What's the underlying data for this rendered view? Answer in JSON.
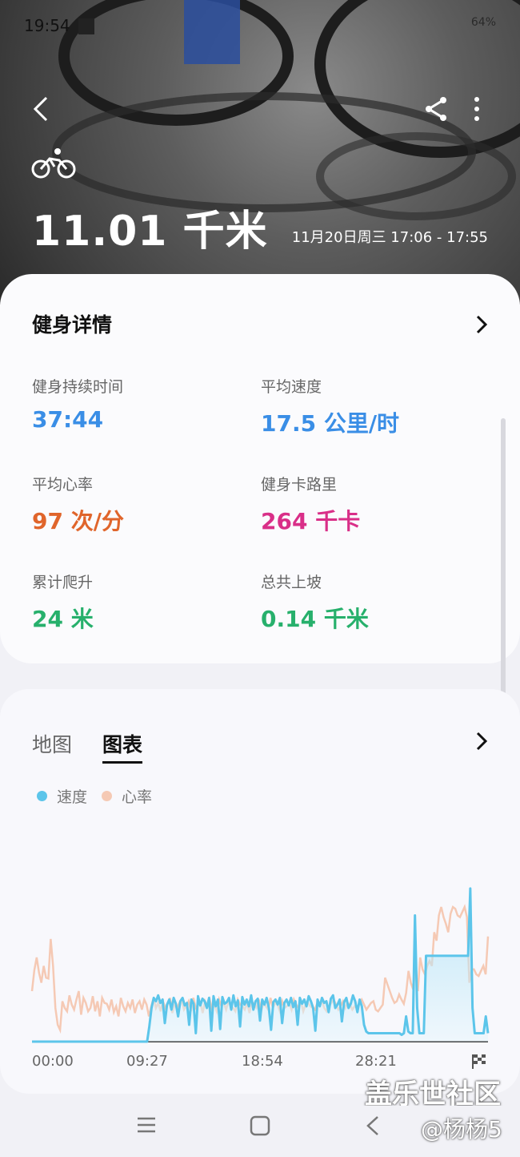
{
  "status_bar": {
    "time": "19:54",
    "battery": "64%"
  },
  "hero": {
    "distance": "11.01 千米",
    "date_range": "11月20日周三 17:06 - 17:55",
    "icons": [
      "back-arrow-icon",
      "share-icon",
      "more-vert-icon",
      "bike-icon"
    ]
  },
  "details": {
    "title": "健身详情",
    "stats": [
      {
        "label": "健身持续时间",
        "value": "37:44",
        "color": "#3a8ee6"
      },
      {
        "label": "平均速度",
        "value": "17.5 公里/时",
        "color": "#3a8ee6"
      },
      {
        "label": "平均心率",
        "value": "97 次/分",
        "color": "#e0652b"
      },
      {
        "label": "健身卡路里",
        "value": "264 千卡",
        "color": "#d92f88"
      },
      {
        "label": "累计爬升",
        "value": "24 米",
        "color": "#27b06c"
      },
      {
        "label": "总共上坡",
        "value": "0.14 千米",
        "color": "#27b06c"
      }
    ]
  },
  "chart_panel": {
    "tabs": [
      {
        "label": "地图",
        "selected": false
      },
      {
        "label": "图表",
        "selected": true
      }
    ],
    "legend": [
      {
        "label": "速度",
        "color": "#5cc5ea"
      },
      {
        "label": "心率",
        "color": "#f5c9b4"
      }
    ],
    "x_labels": [
      "00:00",
      "09:27",
      "18:54",
      "28:21"
    ]
  },
  "chart_data": {
    "type": "area",
    "series": [
      {
        "name": "速度",
        "color": "#5cc5ea",
        "values": [
          0,
          0,
          0,
          0,
          0,
          0,
          0,
          0,
          0,
          0,
          0,
          0,
          0,
          0,
          0,
          0,
          0,
          0,
          0,
          0,
          0,
          0,
          0,
          0,
          0,
          0,
          0,
          0,
          0,
          0,
          0,
          0,
          0,
          0,
          0,
          0,
          0,
          0,
          0,
          0,
          0,
          0,
          0,
          0,
          0,
          0,
          0,
          0,
          0,
          0,
          0,
          0,
          0,
          18,
          40,
          52,
          48,
          55,
          46,
          50,
          22,
          44,
          50,
          38,
          52,
          45,
          30,
          48,
          52,
          43,
          46,
          20,
          50,
          45,
          10,
          54,
          43,
          51,
          48,
          40,
          52,
          13,
          54,
          42,
          50,
          15,
          53,
          45,
          47,
          52,
          38,
          55,
          42,
          49,
          18,
          53,
          44,
          50,
          42,
          55,
          38,
          48,
          51,
          25,
          50,
          44,
          52,
          40,
          14,
          47,
          50,
          44,
          52,
          22,
          46,
          50,
          43,
          52,
          41,
          48,
          20,
          52,
          45,
          50,
          42,
          54,
          48,
          40,
          13,
          50,
          42,
          52,
          46,
          48,
          35,
          51,
          55,
          40,
          44,
          50,
          24,
          47,
          52,
          40,
          45,
          55,
          48,
          35,
          50,
          42,
          20,
          12,
          10,
          10,
          10,
          10,
          10,
          10,
          10,
          10,
          10,
          10,
          10,
          10,
          10,
          10,
          10,
          8,
          10,
          30,
          12,
          10,
          10,
          150,
          40,
          10,
          10,
          10,
          102,
          102,
          102,
          102,
          102,
          102,
          102,
          102,
          102,
          102,
          102,
          102,
          102,
          102,
          102,
          102,
          102,
          102,
          102,
          102,
          182,
          40,
          10,
          10,
          10,
          10,
          10,
          30,
          10
        ]
      },
      {
        "name": "心率",
        "color": "#f5c9b4",
        "values": [
          60,
          85,
          100,
          82,
          70,
          90,
          76,
          75,
          122,
          90,
          40,
          20,
          14,
          48,
          40,
          36,
          55,
          44,
          38,
          50,
          60,
          32,
          52,
          46,
          36,
          40,
          54,
          36,
          48,
          30,
          52,
          46,
          45,
          38,
          50,
          35,
          42,
          30,
          52,
          42,
          36,
          46,
          40,
          50,
          34,
          44,
          48,
          38,
          50,
          44,
          30,
          42,
          52,
          40,
          46,
          36,
          48,
          40,
          44,
          52,
          34,
          44,
          40,
          46,
          50,
          38,
          42,
          48,
          36,
          52,
          40,
          44,
          46,
          34,
          48,
          42,
          50,
          38,
          44,
          36,
          50,
          42,
          46,
          38,
          48,
          42,
          40,
          36,
          50,
          44,
          42,
          38,
          46,
          34,
          48,
          44,
          40,
          50,
          36,
          46,
          42,
          38,
          52,
          40,
          46,
          44,
          36,
          48,
          40,
          42,
          46,
          38,
          50,
          44,
          40,
          48,
          36,
          44,
          46,
          42,
          40,
          38,
          46,
          44,
          48,
          40,
          36,
          42,
          46,
          50,
          44,
          38,
          42,
          48,
          40,
          46,
          44,
          38,
          42,
          40,
          46,
          50,
          44,
          38,
          42,
          46,
          48,
          38,
          36,
          40,
          44,
          76,
          68,
          60,
          52,
          46,
          48,
          56,
          50,
          45,
          58,
          84,
          70,
          62,
          90,
          60,
          100,
          86,
          80,
          90,
          96,
          90,
          130,
          120,
          150,
          160,
          148,
          140,
          130,
          152,
          160,
          158,
          150,
          148,
          154,
          160,
          148,
          70,
          86,
          86,
          80,
          78,
          84,
          90,
          80,
          125
        ]
      }
    ],
    "x_ticks": [
      "00:00",
      "09:27",
      "18:54",
      "28:21"
    ],
    "grid": false
  },
  "nav": {
    "icons": [
      "recent-apps-icon",
      "home-icon",
      "back-icon"
    ]
  },
  "watermark": {
    "line1": "盖乐世社区",
    "line2": "@杨杨5"
  }
}
